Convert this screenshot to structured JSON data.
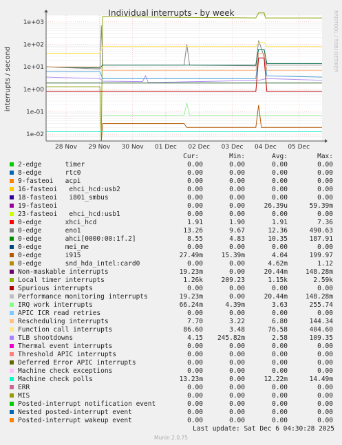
{
  "chart_data": {
    "type": "line",
    "title": "Individual interrupts - by week",
    "ylabel": "interrupts / second",
    "watermark": "RRDTOOL / TOBI OETIKER",
    "y_scale": "log",
    "ylim": [
      0.005,
      2000
    ],
    "y_ticks": [
      {
        "value": 0.01,
        "label": "1e-02"
      },
      {
        "value": 0.1,
        "label": "1e-01"
      },
      {
        "value": 1,
        "label": "1e+00"
      },
      {
        "value": 10,
        "label": "1e+01"
      },
      {
        "value": 100,
        "label": "1e+02"
      },
      {
        "value": 1000,
        "label": "1e+03"
      }
    ],
    "x_ticks": [
      "28 Nov",
      "29 Nov",
      "30 Nov",
      "01 Dec",
      "02 Dec",
      "03 Dec",
      "04 Dec",
      "05 Dec"
    ],
    "series": [
      {
        "name": "Local timer interrupts",
        "color": "#8fa00b",
        "points": [
          [
            0,
            1.3
          ],
          [
            0.195,
            1.3
          ],
          [
            0.2,
            0.003
          ],
          [
            0.205,
            1700
          ],
          [
            0.76,
            1500
          ],
          [
            0.77,
            2500
          ],
          [
            0.79,
            2500
          ],
          [
            0.795,
            1500
          ],
          [
            1,
            1500
          ]
        ]
      },
      {
        "name": "TLB shootdowns",
        "color": "#b08ef0",
        "points": [
          [
            0,
            3.5
          ],
          [
            0.195,
            3
          ],
          [
            0.205,
            2.3
          ],
          [
            0.35,
            2.2
          ],
          [
            0.36,
            4
          ],
          [
            0.37,
            2
          ],
          [
            0.77,
            2.5
          ],
          [
            0.8,
            3
          ],
          [
            1,
            2.5
          ]
        ]
      },
      {
        "name": "ahci[0000:00:1f.2]",
        "color": "#888888",
        "points": [
          [
            0,
            10
          ],
          [
            0.195,
            8
          ],
          [
            0.2,
            700
          ],
          [
            0.205,
            12
          ],
          [
            0.5,
            12
          ],
          [
            0.51,
            100
          ],
          [
            0.52,
            12
          ],
          [
            0.76,
            11
          ],
          [
            0.77,
            150
          ],
          [
            0.8,
            12
          ],
          [
            1,
            12
          ]
        ]
      },
      {
        "name": "eno1",
        "color": "#00684c",
        "points": [
          [
            0,
            10
          ],
          [
            0.195,
            9
          ],
          [
            0.205,
            12
          ],
          [
            0.76,
            12
          ],
          [
            0.77,
            60
          ],
          [
            0.79,
            60
          ],
          [
            0.8,
            14
          ],
          [
            1,
            14
          ]
        ]
      },
      {
        "name": "IRQ work interrupts",
        "color": "#4a9bd1",
        "points": [
          [
            0,
            6
          ],
          [
            0.195,
            6
          ],
          [
            0.205,
            3
          ],
          [
            0.76,
            3
          ],
          [
            0.77,
            40
          ],
          [
            0.79,
            40
          ],
          [
            0.8,
            4
          ],
          [
            1,
            3.5
          ]
        ]
      },
      {
        "name": "Function call interrupts",
        "color": "#ffe15b",
        "points": [
          [
            0,
            40
          ],
          [
            0.195,
            40
          ],
          [
            0.205,
            80
          ],
          [
            0.76,
            80
          ],
          [
            0.77,
            120
          ],
          [
            0.79,
            120
          ],
          [
            0.8,
            80
          ],
          [
            1,
            80
          ]
        ]
      },
      {
        "name": "Rescheduling interrupts",
        "color": "#ffb380",
        "points": [
          [
            0,
            10
          ],
          [
            0.195,
            10
          ],
          [
            0.205,
            7
          ],
          [
            0.76,
            7
          ],
          [
            0.77,
            40
          ],
          [
            0.79,
            40
          ],
          [
            0.8,
            7
          ],
          [
            1,
            7
          ]
        ]
      },
      {
        "name": "Spurious interrupts",
        "color": "#c20000",
        "points": [
          [
            0,
            0.8
          ],
          [
            0.76,
            0.8
          ],
          [
            0.77,
            25
          ],
          [
            0.79,
            25
          ],
          [
            0.8,
            0.8
          ],
          [
            1,
            0.8
          ]
        ]
      },
      {
        "name": "xhci_hcd",
        "color": "#2d6b2d",
        "points": [
          [
            0,
            1.9
          ],
          [
            0.195,
            1.9
          ],
          [
            0.205,
            1.9
          ],
          [
            1,
            1.9
          ]
        ]
      },
      {
        "name": "Performance monitoring interrupts",
        "color": "#9bee9b",
        "points": [
          [
            0.205,
            0.07
          ],
          [
            0.5,
            0.07
          ],
          [
            0.51,
            0.25
          ],
          [
            0.52,
            0.07
          ],
          [
            0.76,
            0.07
          ],
          [
            1,
            0.07
          ]
        ]
      },
      {
        "name": "i915",
        "color": "#b25400",
        "points": [
          [
            0,
            0.003
          ],
          [
            0.2,
            0.003
          ],
          [
            0.205,
            0.03
          ],
          [
            0.5,
            0.03
          ],
          [
            0.51,
            0.02
          ],
          [
            0.76,
            0.02
          ],
          [
            0.77,
            0.2
          ],
          [
            0.78,
            0.02
          ],
          [
            1,
            0.02
          ]
        ]
      },
      {
        "name": "Machine check polls",
        "color": "#2de9d0",
        "points": [
          [
            0,
            0.013
          ],
          [
            1,
            0.013
          ]
        ]
      }
    ]
  },
  "legend": {
    "headers": {
      "cur": "Cur:",
      "min": "Min:",
      "avg": "Avg:",
      "max": "Max:"
    },
    "rows": [
      {
        "label": "2-edge      timer",
        "color": "#00cc00",
        "cur": "0.00",
        "min": "0.00",
        "avg": "0.00",
        "max": "0.00"
      },
      {
        "label": "8-edge      rtc0",
        "color": "#0066b3",
        "cur": "0.00",
        "min": "0.00",
        "avg": "0.00",
        "max": "0.00"
      },
      {
        "label": "9-fasteoi   acpi",
        "color": "#ff8000",
        "cur": "0.00",
        "min": "0.00",
        "avg": "0.00",
        "max": "0.00"
      },
      {
        "label": "16-fasteoi   ehci_hcd:usb2",
        "color": "#ffcc00",
        "cur": "0.00",
        "min": "0.00",
        "avg": "0.00",
        "max": "0.00"
      },
      {
        "label": "18-fasteoi   i801_smbus",
        "color": "#330099",
        "cur": "0.00",
        "min": "0.00",
        "avg": "0.00",
        "max": "0.00"
      },
      {
        "label": "19-fasteoi",
        "color": "#990099",
        "cur": "0.00",
        "min": "0.00",
        "avg": "26.39u",
        "max": "59.39m"
      },
      {
        "label": "23-fasteoi   ehci_hcd:usb1",
        "color": "#ccff00",
        "cur": "0.00",
        "min": "0.00",
        "avg": "0.00",
        "max": "0.00"
      },
      {
        "label": "0-edge      xhci_hcd",
        "color": "#ff0000",
        "cur": "1.91",
        "min": "1.90",
        "avg": "1.91",
        "max": "7.36"
      },
      {
        "label": "0-edge      eno1",
        "color": "#808080",
        "cur": "13.26",
        "min": "9.67",
        "avg": "12.36",
        "max": "490.63"
      },
      {
        "label": "0-edge      ahci[0000:00:1f.2]",
        "color": "#008f00",
        "cur": "8.55",
        "min": "4.83",
        "avg": "10.35",
        "max": "187.91"
      },
      {
        "label": "0-edge      mei_me",
        "color": "#00487d",
        "cur": "0.00",
        "min": "0.00",
        "avg": "0.00",
        "max": "0.00"
      },
      {
        "label": "0-edge      i915",
        "color": "#b35a00",
        "cur": "27.49m",
        "min": "15.39m",
        "avg": "4.04",
        "max": "199.97"
      },
      {
        "label": "0-edge      snd_hda_intel:card0",
        "color": "#b38f00",
        "cur": "0.00",
        "min": "0.00",
        "avg": "4.62m",
        "max": "1.12"
      },
      {
        "label": "Non-maskable interrupts",
        "color": "#6b006b",
        "cur": "19.23m",
        "min": "0.00",
        "avg": "20.44m",
        "max": "148.28m"
      },
      {
        "label": "Local timer interrupts",
        "color": "#8fb300",
        "cur": "1.26k",
        "min": "209.23",
        "avg": "1.15k",
        "max": "2.59k"
      },
      {
        "label": "Spurious interrupts",
        "color": "#b30000",
        "cur": "0.00",
        "min": "0.00",
        "avg": "0.00",
        "max": "0.00"
      },
      {
        "label": "Performance monitoring interrupts",
        "color": "#bebebe",
        "cur": "19.23m",
        "min": "0.00",
        "avg": "20.44m",
        "max": "148.28m"
      },
      {
        "label": "IRQ work interrupts",
        "color": "#80ff80",
        "cur": "66.24m",
        "min": "4.39m",
        "avg": "3.63",
        "max": "255.74"
      },
      {
        "label": "APIC ICR read retries",
        "color": "#80c9ff",
        "cur": "0.00",
        "min": "0.00",
        "avg": "0.00",
        "max": "0.00"
      },
      {
        "label": "Rescheduling interrupts",
        "color": "#ffc080",
        "cur": "7.70",
        "min": "3.22",
        "avg": "6.80",
        "max": "144.34"
      },
      {
        "label": "Function call interrupts",
        "color": "#ffe680",
        "cur": "86.60",
        "min": "3.48",
        "avg": "76.58",
        "max": "404.60"
      },
      {
        "label": "TLB shootdowns",
        "color": "#aa80ff",
        "cur": "4.15",
        "min": "245.82m",
        "avg": "2.58",
        "max": "109.35"
      },
      {
        "label": "Thermal event interrupts",
        "color": "#ee00cc",
        "cur": "0.00",
        "min": "0.00",
        "avg": "0.00",
        "max": "0.00"
      },
      {
        "label": "Threshold APIC interrupts",
        "color": "#ff8080",
        "cur": "0.00",
        "min": "0.00",
        "avg": "0.00",
        "max": "0.00"
      },
      {
        "label": "Deferred Error APIC interrupts",
        "color": "#666600",
        "cur": "0.00",
        "min": "0.00",
        "avg": "0.00",
        "max": "0.00"
      },
      {
        "label": "Machine check exceptions",
        "color": "#ffbfff",
        "cur": "0.00",
        "min": "0.00",
        "avg": "0.00",
        "max": "0.00"
      },
      {
        "label": "Machine check polls",
        "color": "#00ffcc",
        "cur": "13.23m",
        "min": "0.00",
        "avg": "12.22m",
        "max": "14.49m"
      },
      {
        "label": "ERR",
        "color": "#cc6699",
        "cur": "0.00",
        "min": "0.00",
        "avg": "0.00",
        "max": "0.00"
      },
      {
        "label": "MIS",
        "color": "#999900",
        "cur": "0.00",
        "min": "0.00",
        "avg": "0.00",
        "max": "0.00"
      },
      {
        "label": "Posted-interrupt notification event",
        "color": "#00cc00",
        "cur": "0.00",
        "min": "0.00",
        "avg": "0.00",
        "max": "0.00"
      },
      {
        "label": "Nested posted-interrupt event",
        "color": "#0066b3",
        "cur": "0.00",
        "min": "0.00",
        "avg": "0.00",
        "max": "0.00"
      },
      {
        "label": "Posted-interrupt wakeup event",
        "color": "#ff8000",
        "cur": "0.00",
        "min": "0.00",
        "avg": "0.00",
        "max": "0.00"
      }
    ]
  },
  "footer": {
    "last_update": "Last update: Sat Dec  6 04:30:28 2025",
    "version": "Munin 2.0.75"
  }
}
